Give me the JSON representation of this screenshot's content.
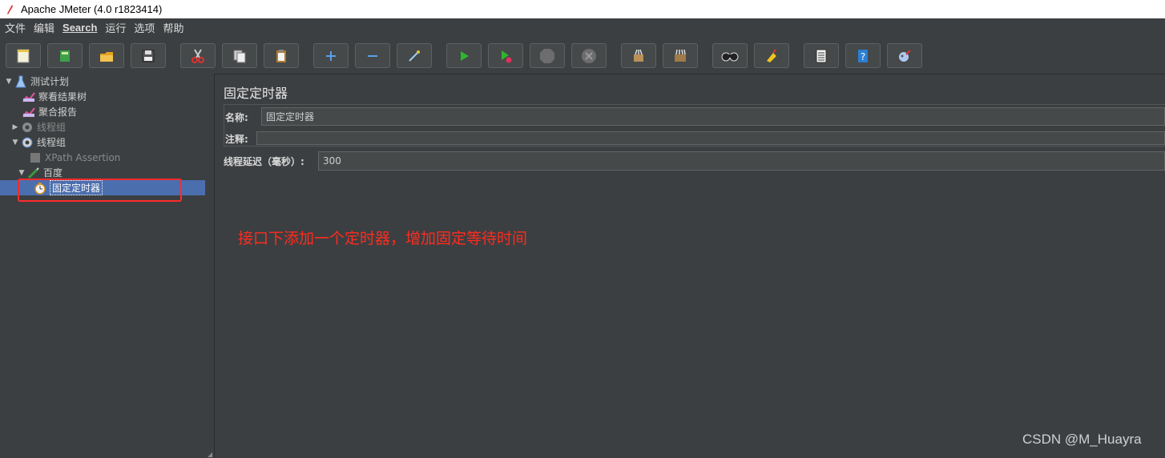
{
  "window": {
    "title": "Apache JMeter (4.0 r1823414)"
  },
  "menu": [
    "文件",
    "编辑",
    "Search",
    "运行",
    "选项",
    "帮助"
  ],
  "toolbar": [
    {
      "name": "new-icon"
    },
    {
      "name": "templates-icon"
    },
    {
      "name": "open-icon"
    },
    {
      "name": "save-icon"
    },
    {
      "name": "cut-icon"
    },
    {
      "name": "copy-icon"
    },
    {
      "name": "paste-icon"
    },
    {
      "name": "expand-icon"
    },
    {
      "name": "collapse-icon"
    },
    {
      "name": "toggle-icon"
    },
    {
      "name": "start-icon"
    },
    {
      "name": "start-no-pauses-icon"
    },
    {
      "name": "stop-icon"
    },
    {
      "name": "shutdown-icon"
    },
    {
      "name": "clear-icon"
    },
    {
      "name": "clear-all-icon"
    },
    {
      "name": "search-icon"
    },
    {
      "name": "reset-search-icon"
    },
    {
      "name": "function-helper-icon"
    },
    {
      "name": "help-icon"
    },
    {
      "name": "remote-icon"
    }
  ],
  "tree": {
    "items": [
      {
        "label": "测试计划"
      },
      {
        "label": "察看结果树"
      },
      {
        "label": "聚合报告"
      },
      {
        "label": "线程组"
      },
      {
        "label": "线程组"
      },
      {
        "label": "XPath Assertion"
      },
      {
        "label": "百度"
      },
      {
        "label": "固定定时器"
      }
    ]
  },
  "panel": {
    "title": "固定定时器",
    "name_label": "名称:",
    "name_value": "固定定时器",
    "comment_label": "注释:",
    "comment_value": "",
    "delay_label": "线程延迟（毫秒）:",
    "delay_value": "300"
  },
  "annotation": "接口下添加一个定时器，增加固定等待时间",
  "watermark": "CSDN @M_Huayra",
  "colors": {
    "background": "#3c3f41",
    "selection": "#4b6eaf",
    "annotation": "#ff2b1f"
  }
}
